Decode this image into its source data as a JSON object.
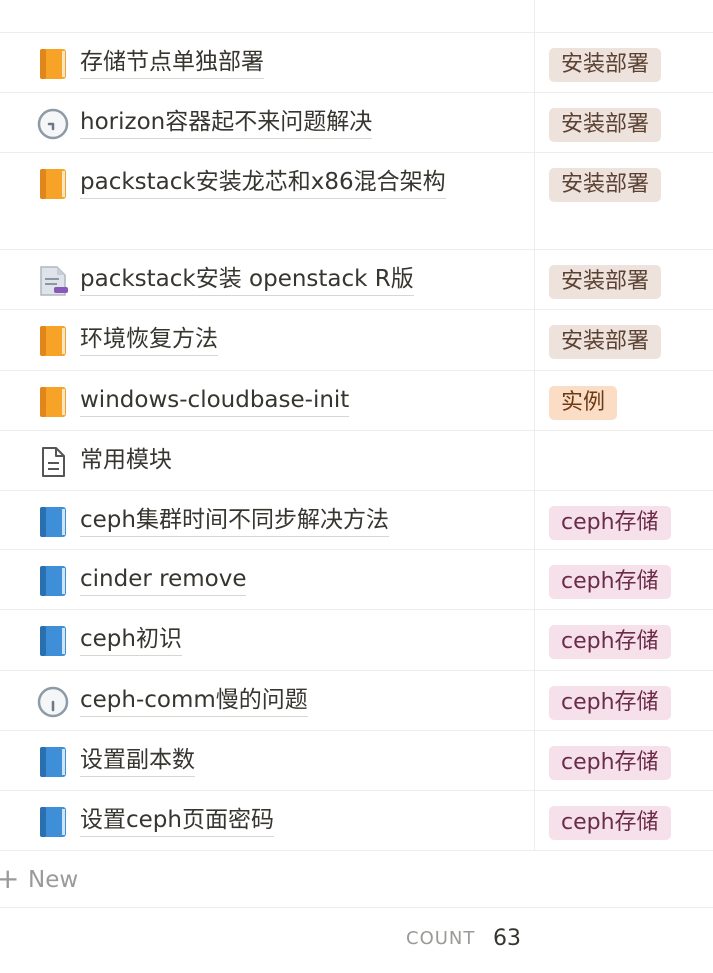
{
  "rows": [
    {
      "title": "存储节点单独部署",
      "icon": "orange-book-icon",
      "tag": "安装部署",
      "tag_kind": "install"
    },
    {
      "title": "horizon容器起不来问题解决",
      "icon": "clock-icon",
      "tag": "安装部署",
      "tag_kind": "install"
    },
    {
      "title": "packstack安装龙芯和x86混合架构",
      "icon": "orange-book-icon",
      "tag": "安装部署",
      "tag_kind": "install"
    },
    {
      "title": "packstack安装 openstack R版",
      "icon": "document-pen-icon",
      "tag": "安装部署",
      "tag_kind": "install"
    },
    {
      "title": "环境恢复方法",
      "icon": "orange-book-icon",
      "tag": "安装部署",
      "tag_kind": "install"
    },
    {
      "title": "windows-cloudbase-init",
      "icon": "orange-book-icon",
      "tag": "实例",
      "tag_kind": "example"
    },
    {
      "title": "常用模块",
      "icon": "page-icon",
      "tag": "",
      "tag_kind": ""
    },
    {
      "title": "ceph集群时间不同步解决方法",
      "icon": "blue-book-icon",
      "tag": "ceph存储",
      "tag_kind": "ceph"
    },
    {
      "title": "cinder remove",
      "icon": "blue-book-icon",
      "tag": "ceph存储",
      "tag_kind": "ceph"
    },
    {
      "title": "ceph初识",
      "icon": "blue-book-icon",
      "tag": "ceph存储",
      "tag_kind": "ceph"
    },
    {
      "title": "ceph-comm慢的问题",
      "icon": "clock-icon",
      "tag": "ceph存储",
      "tag_kind": "ceph"
    },
    {
      "title": "设置副本数",
      "icon": "blue-book-icon",
      "tag": "ceph存储",
      "tag_kind": "ceph"
    },
    {
      "title": "设置ceph页面密码",
      "icon": "blue-book-icon",
      "tag": "ceph存储",
      "tag_kind": "ceph"
    }
  ],
  "new_row": {
    "label": "New"
  },
  "footer": {
    "count_label": "COUNT",
    "count_value": "63"
  }
}
